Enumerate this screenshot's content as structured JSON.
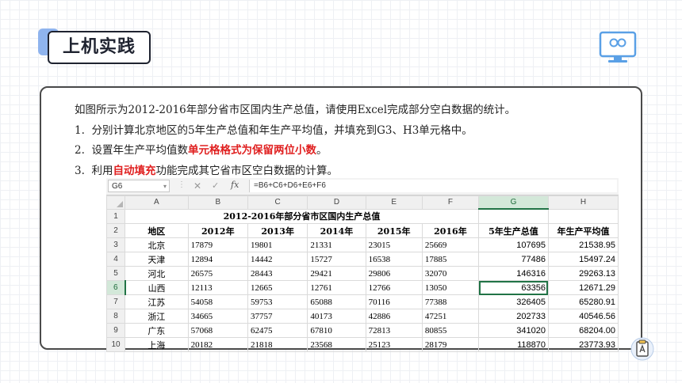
{
  "title": "上机实践",
  "instructions": {
    "intro": "如图所示为2012-2016年部分省市区国内生产总值，请使用Excel完成部分空白数据的统计。",
    "item1_num": "1.",
    "item1": "分别计算北京地区的5年生产总值和年生产平均值，并填充到G3、H3单元格中。",
    "item2_num": "2.",
    "item2_pre": "设置年生产平均值数",
    "item2_red": "单元格格式为保留两位小数",
    "item2_post": "。",
    "item3_num": "3.",
    "item3_pre": "利用",
    "item3_red": "自动填充",
    "item3_post": "功能完成其它省市区空白数据的计算。"
  },
  "formula_bar": {
    "name_box": "G6",
    "fx": "fx",
    "formula": "=B6+C6+D6+E6+F6"
  },
  "sheet": {
    "columns": [
      "A",
      "B",
      "C",
      "D",
      "E",
      "F",
      "G",
      "H"
    ],
    "table_title": "2012-2016年部分省市区国内生产总值",
    "headers": [
      "地区",
      "2012年",
      "2013年",
      "2014年",
      "2015年",
      "2016年",
      "5年生产总值",
      "年生产平均值"
    ],
    "rows": [
      {
        "n": "3",
        "cells": [
          "北京",
          "17879",
          "19801",
          "21331",
          "23015",
          "25669",
          "107695",
          "21538.95"
        ]
      },
      {
        "n": "4",
        "cells": [
          "天津",
          "12894",
          "14442",
          "15727",
          "16538",
          "17885",
          "77486",
          "15497.24"
        ]
      },
      {
        "n": "5",
        "cells": [
          "河北",
          "26575",
          "28443",
          "29421",
          "29806",
          "32070",
          "146316",
          "29263.13"
        ]
      },
      {
        "n": "6",
        "cells": [
          "山西",
          "12113",
          "12665",
          "12761",
          "12766",
          "13050",
          "63356",
          "12671.29"
        ]
      },
      {
        "n": "7",
        "cells": [
          "江苏",
          "54058",
          "59753",
          "65088",
          "70116",
          "77388",
          "326405",
          "65280.91"
        ]
      },
      {
        "n": "8",
        "cells": [
          "浙江",
          "34665",
          "37757",
          "40173",
          "42886",
          "47251",
          "202733",
          "40546.56"
        ]
      },
      {
        "n": "9",
        "cells": [
          "广东",
          "57068",
          "62475",
          "67810",
          "72813",
          "80855",
          "341020",
          "68204.00"
        ]
      },
      {
        "n": "10",
        "cells": [
          "上海",
          "20182",
          "21818",
          "23568",
          "25123",
          "28179",
          "118870",
          "23773.93"
        ]
      }
    ],
    "selected_column": "G",
    "selected_row": "6"
  },
  "colors": {
    "highlight_red": "#e02020",
    "excel_green": "#217346",
    "accent_blue": "#8fb4ee"
  },
  "icons": [
    "monitor-icon",
    "document-icon"
  ]
}
